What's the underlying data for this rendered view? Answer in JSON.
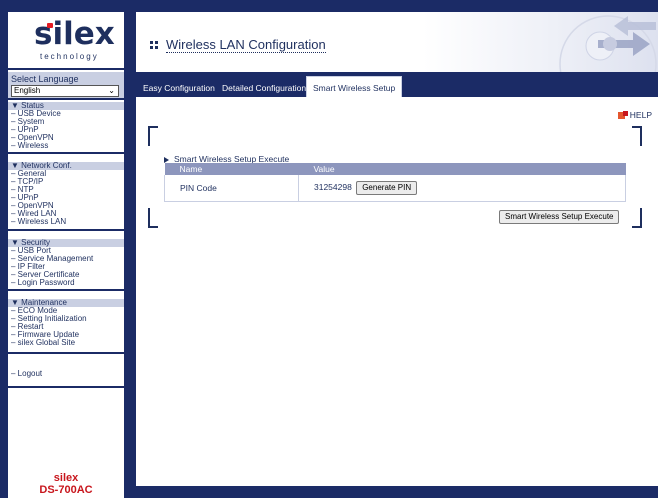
{
  "logo": {
    "brand": "silex",
    "tagline": "technology"
  },
  "language": {
    "label": "Select Language",
    "selected": "English"
  },
  "sidebar": {
    "groups": [
      {
        "title": "▼ Status",
        "items": [
          "– USB Device",
          "– System",
          "– UPnP",
          "– OpenVPN",
          "– Wireless"
        ]
      },
      {
        "title": "▼ Network Conf.",
        "items": [
          "– General",
          "– TCP/IP",
          "– NTP",
          "– UPnP",
          "– OpenVPN",
          "– Wired LAN",
          "– Wireless LAN"
        ]
      },
      {
        "title": "▼ Security",
        "items": [
          "– USB Port",
          "– Service Management",
          "– IP Filter",
          "– Server Certificate",
          "– Login Password"
        ]
      },
      {
        "title": "▼ Maintenance",
        "items": [
          "– ECO Mode",
          "– Setting Initialization",
          "– Restart",
          "– Firmware Update",
          "– silex Global Site"
        ]
      }
    ],
    "logout": "– Logout"
  },
  "product": {
    "brand": "silex",
    "model": "DS-700AC"
  },
  "header": {
    "title": "Wireless LAN Configuration"
  },
  "tabs": [
    {
      "label": "Easy Configuration",
      "active": false
    },
    {
      "label": "Detailed Configuration",
      "active": false
    },
    {
      "label": "Smart Wireless Setup",
      "active": true
    }
  ],
  "help": {
    "label": "HELP"
  },
  "section": {
    "title": "Smart Wireless Setup Execute",
    "columns": {
      "name": "Name",
      "value": "Value"
    },
    "rows": [
      {
        "name": "PIN Code",
        "value": "31254298",
        "button": "Generate PIN"
      }
    ],
    "execute_button": "Smart Wireless Setup Execute"
  },
  "colors": {
    "navy": "#1b2b66",
    "light_band": "#c9cfe2",
    "table_header": "#8d96bd",
    "brand_red": "#c8161d"
  }
}
